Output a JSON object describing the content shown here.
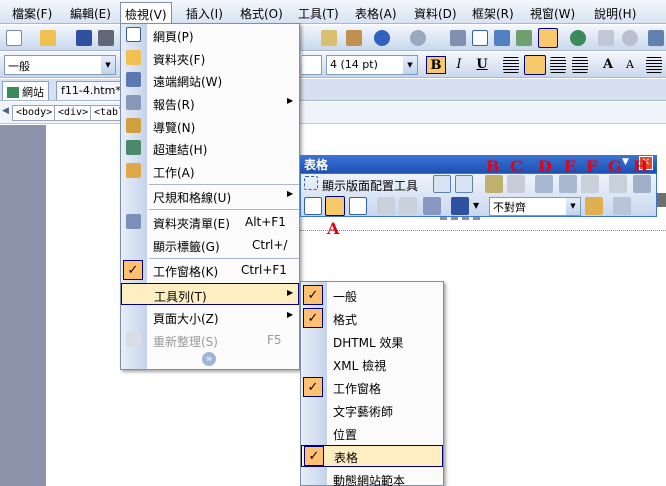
{
  "menubar": {
    "file": "檔案(F)",
    "edit": "編輯(E)",
    "view": "檢視(V)",
    "insert": "插入(I)",
    "format": "格式(O)",
    "tools": "工具(T)",
    "table": "表格(A)",
    "data": "資料(D)",
    "frames": "框架(R)",
    "window": "視窗(W)",
    "help": "說明(H)"
  },
  "format_toolbar": {
    "style_value": "一般",
    "font_value": "",
    "size_value": "4  (14 pt)",
    "bold": "B",
    "italic": "I",
    "underline": "U",
    "grow_font": "A",
    "shrink_font": "A"
  },
  "tabs": {
    "site": "網站",
    "file": "f11-4.htm*"
  },
  "breadcrumbs": {
    "body": "<body>",
    "div": "<div>",
    "table": "<table"
  },
  "view_menu": {
    "items": [
      {
        "label": "網頁(P)"
      },
      {
        "label": "資料夾(F)"
      },
      {
        "label": "遠端網站(W)"
      },
      {
        "label": "報告(R)",
        "submenu": "▶"
      },
      {
        "label": "導覽(N)"
      },
      {
        "label": "超連結(H)"
      },
      {
        "label": "工作(A)"
      },
      {
        "label": "尺規和格線(U)",
        "submenu": "▶"
      },
      {
        "label": "資料夾清單(E)",
        "shortcut": "Alt+F1"
      },
      {
        "label": "顯示標籤(G)",
        "shortcut": "Ctrl+/"
      },
      {
        "label": "工作窗格(K)",
        "shortcut": "Ctrl+F1",
        "check": "✓"
      },
      {
        "label": "工具列(T)",
        "submenu": "▶"
      },
      {
        "label": "頁面大小(Z)",
        "submenu": "▶"
      },
      {
        "label": "重新整理(S)",
        "shortcut": "F5"
      }
    ],
    "more": "»"
  },
  "toolbar_submenu": {
    "items": [
      {
        "label": "一般",
        "check": "✓"
      },
      {
        "label": "格式",
        "check": "✓"
      },
      {
        "label": "DHTML 效果"
      },
      {
        "label": "XML 檢視"
      },
      {
        "label": "工作窗格",
        "check": "✓"
      },
      {
        "label": "文字藝術師"
      },
      {
        "label": "位置"
      },
      {
        "label": "表格",
        "check": "✓"
      },
      {
        "label": "動態網站範本"
      }
    ]
  },
  "table_toolbar": {
    "title": "表格",
    "layout_tools": "顯示版面配置工具",
    "align_value": "不對齊",
    "close": "✕"
  },
  "annotations": {
    "a": "A",
    "b": "B",
    "c": "C",
    "d": "D",
    "e": "E",
    "f": "F",
    "g": "G",
    "h": "H"
  },
  "colors": {
    "highlight": "#ffeec2",
    "check_bg": "#ffc070",
    "title_bar": "#1e50b4",
    "annotation": "#e60012"
  }
}
